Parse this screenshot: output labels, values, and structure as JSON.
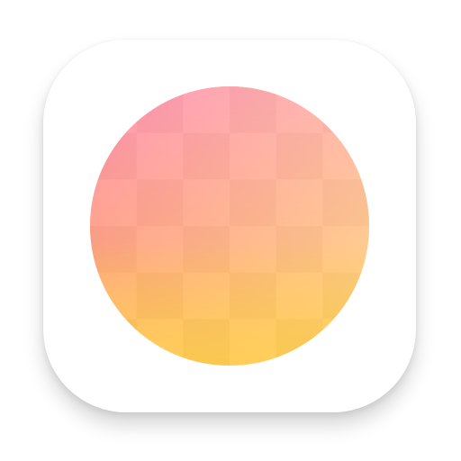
{
  "icon": {
    "name": "app-icon",
    "background_color": "#ffffff",
    "orb": {
      "gradient": {
        "top_left": "#FF93B5",
        "top_right": "#FFB8AE",
        "bottom_left": "#FFAE64",
        "bottom_right": "#FFD575",
        "bottom": "#FFCF4E"
      },
      "grid": {
        "columns": 6,
        "rows": 6
      }
    }
  }
}
